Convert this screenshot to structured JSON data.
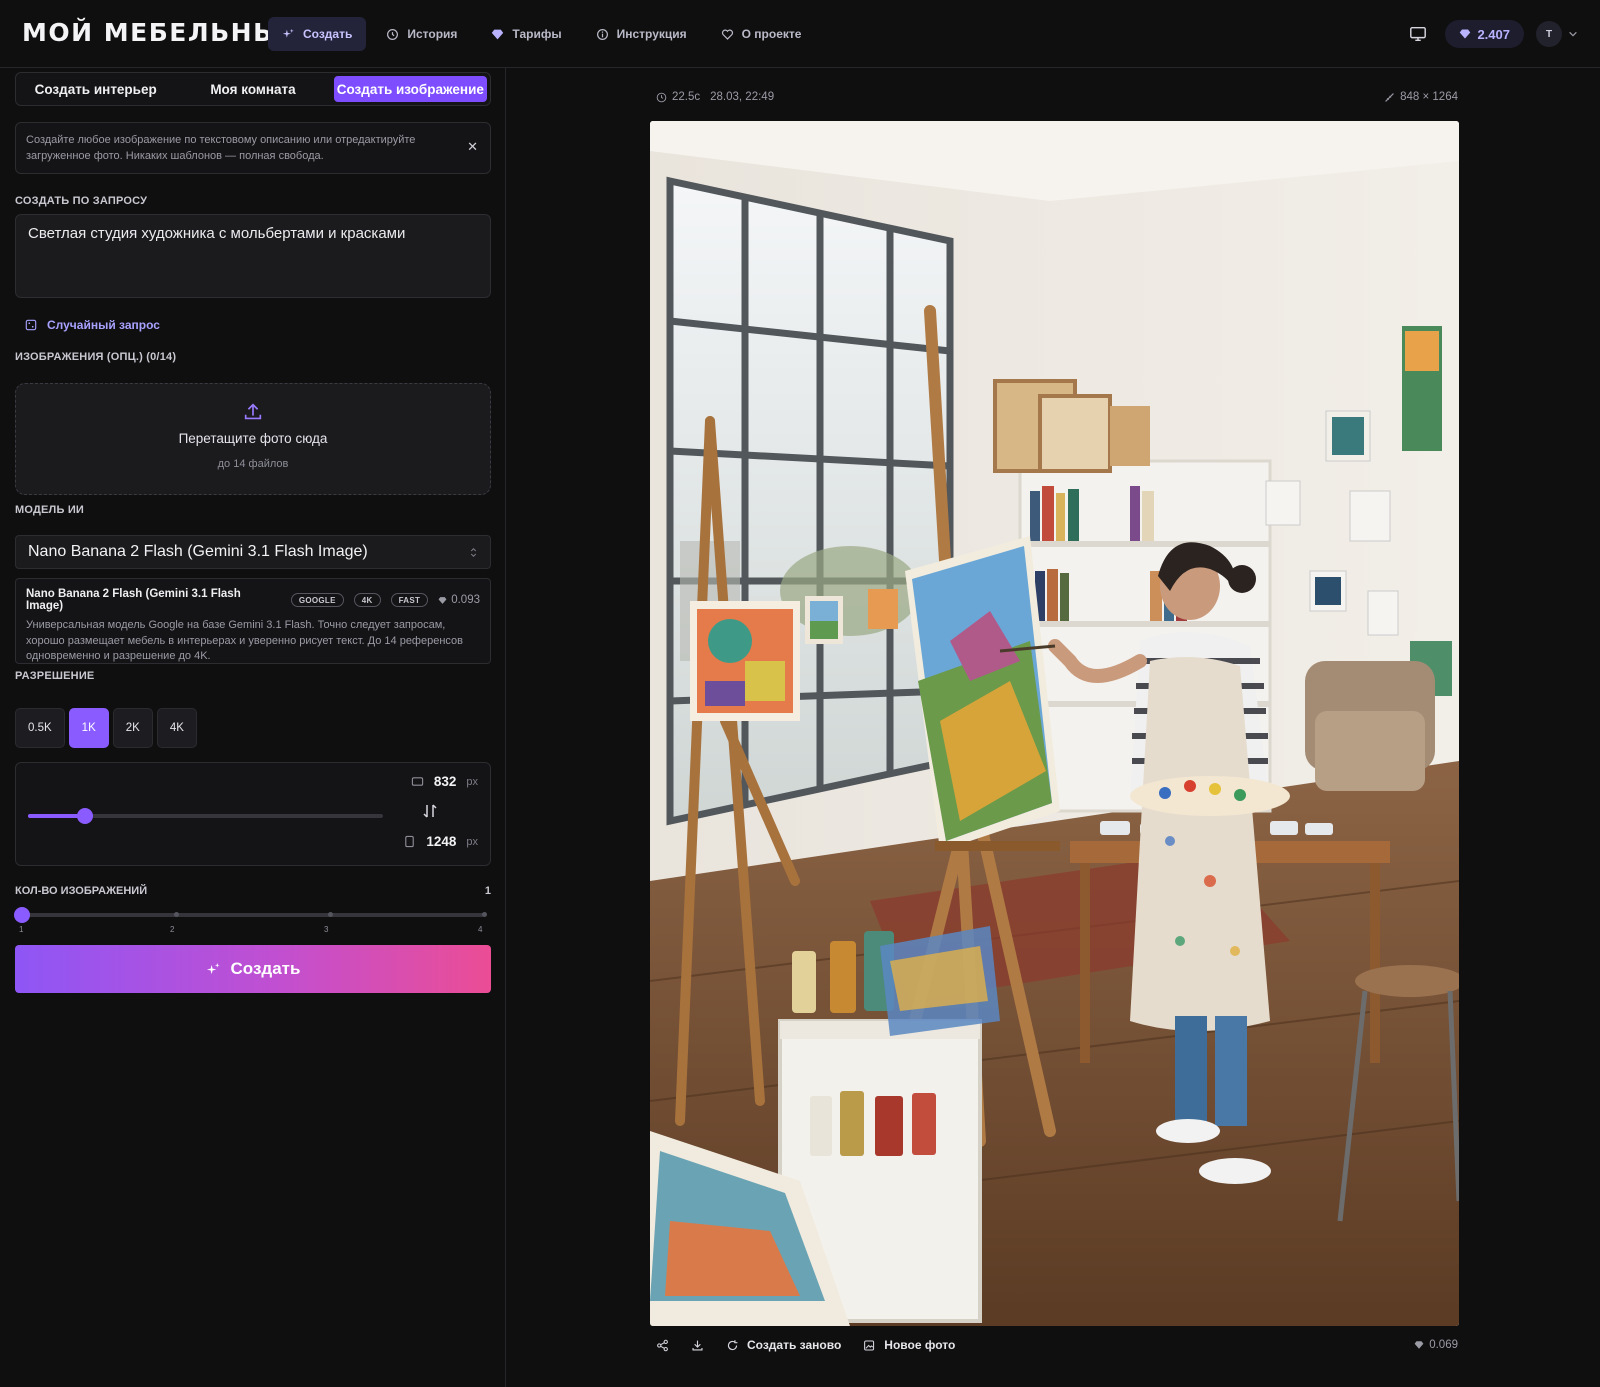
{
  "header": {
    "logo": "МОЙ МЕБЕЛЬНЫЙ",
    "nav": [
      {
        "label": "Создать",
        "icon": "sparkle-icon",
        "active": true
      },
      {
        "label": "История",
        "icon": "history-icon",
        "active": false
      },
      {
        "label": "Тарифы",
        "icon": "gem-icon",
        "active": false
      },
      {
        "label": "Инструкция",
        "icon": "info-icon",
        "active": false
      },
      {
        "label": "О проекте",
        "icon": "heart-icon",
        "active": false
      }
    ],
    "balance": "2.407",
    "avatar_initial": "Т"
  },
  "left": {
    "tabs": [
      "Создать интерьер",
      "Моя комната",
      "Создать изображение"
    ],
    "active_tab": "Создать изображение",
    "info_text": "Создайте любое изображение по текстовому описанию или отредактируйте загруженное фото. Никаких шаблонов — полная свобода.",
    "prompt_label": "СОЗДАТЬ ПО ЗАПРОСУ",
    "prompt_value": "Светлая студия художника с мольбертами и красками",
    "random_label": "Случайный запрос",
    "images_label": "ИЗОБРАЖЕНИЯ (ОПЦ.) (0/14)",
    "dropzone_title": "Перетащите фото сюда",
    "dropzone_sub": "до 14 файлов",
    "model_label": "МОДЕЛЬ ИИ",
    "model_selected": "Nano Banana 2 Flash (Gemini 3.1 Flash Image)",
    "model_card": {
      "name": "Nano Banana 2 Flash (Gemini 3.1 Flash Image)",
      "badges": [
        "GOOGLE",
        "4K",
        "FAST"
      ],
      "price": "0.093",
      "description": "Универсальная модель Google на базе Gemini 3.1 Flash. Точно следует запросам, хорошо размещает мебель в интерьерах и уверенно рисует текст. До 14 референсов одновременно и разрешение до 4K."
    },
    "resolution_label": "РАЗРЕШЕНИЕ",
    "resolutions": [
      "0.5K",
      "1K",
      "2K",
      "4K"
    ],
    "resolution_active": "1K",
    "aspect_slider_fraction": 0.16,
    "width": "832",
    "height": "1248",
    "unit": "px",
    "count_label": "КОЛ-ВО ИЗОБРАЖЕНИЙ",
    "count_value": "1",
    "count_ticks": [
      "1",
      "2",
      "3",
      "4"
    ],
    "create_label": "Создать"
  },
  "result": {
    "duration": "22.5с",
    "datetime": "28.03, 22:49",
    "dimensions": "848 × 1264",
    "actions": {
      "regenerate": "Создать заново",
      "new_photo": "Новое фото"
    },
    "cost": "0.069"
  },
  "colors": {
    "accent": "#8a5cff",
    "gradient_start": "#8e56f6",
    "gradient_end": "#eb4d95"
  }
}
